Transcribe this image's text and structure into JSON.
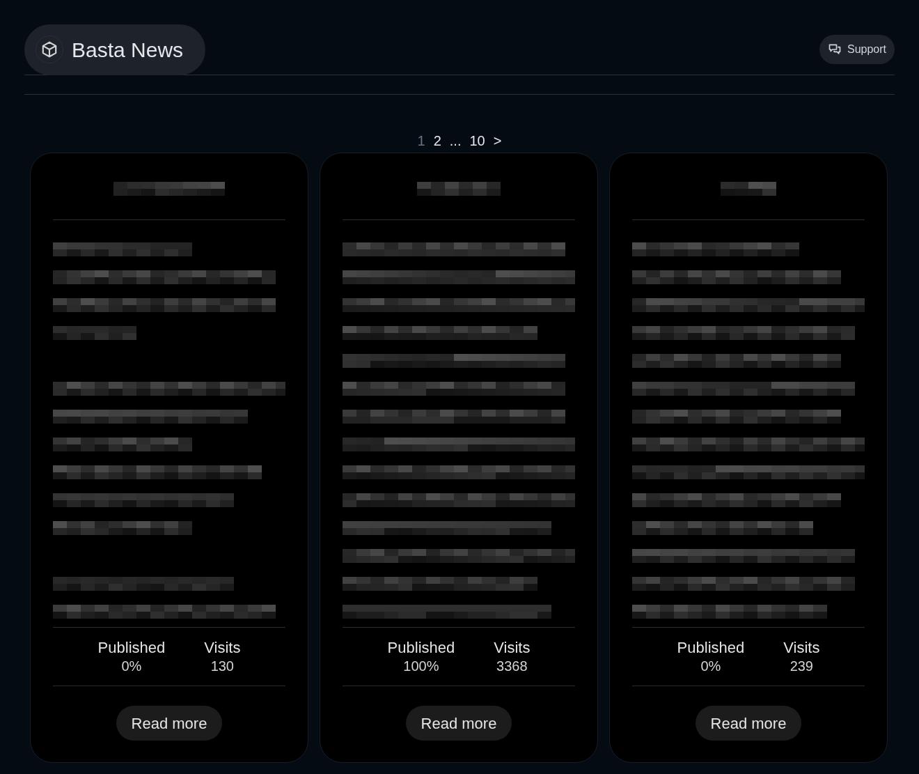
{
  "brand": {
    "title": "Basta News"
  },
  "support": {
    "label": "Support"
  },
  "pagination": [
    {
      "label": "1",
      "selected": true
    },
    {
      "label": "2",
      "selected": false
    },
    {
      "label": "...",
      "selected": false
    },
    {
      "label": "10",
      "selected": false
    },
    {
      "label": ">",
      "selected": false
    }
  ],
  "cards": [
    {
      "stats": [
        {
          "label": "Published",
          "value": "0%"
        },
        {
          "label": "Visits",
          "value": "130"
        }
      ],
      "button": "Read more"
    },
    {
      "stats": [
        {
          "label": "Published",
          "value": "100%"
        },
        {
          "label": "Visits",
          "value": "3368"
        }
      ],
      "button": "Read more"
    },
    {
      "stats": [
        {
          "label": "Published",
          "value": "0%"
        },
        {
          "label": "Visits",
          "value": "239"
        }
      ],
      "button": "Read more"
    }
  ]
}
